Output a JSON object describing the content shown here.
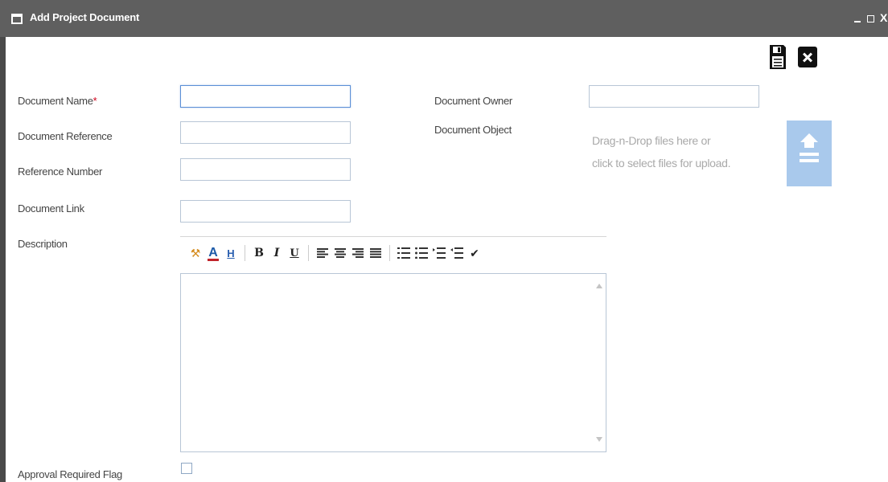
{
  "window": {
    "title": "Add Project Document",
    "close_glyph": "X"
  },
  "form": {
    "document_name_label": "Document Name",
    "required_marker": "*",
    "document_owner_label": "Document Owner",
    "document_reference_label": "Document Reference",
    "document_object_label": "Document Object",
    "reference_number_label": "Reference Number",
    "document_link_label": "Document Link",
    "description_label": "Description",
    "approval_required_label": "Approval Required Flag",
    "document_name_value": "",
    "document_owner_value": "",
    "document_reference_value": "",
    "reference_number_value": "",
    "document_link_value": "",
    "approval_required_checked": false
  },
  "upload": {
    "line1": "Drag-n-Drop files here or",
    "line2": "click to select files for upload."
  },
  "toolbar": {
    "font_color_glyph": "A",
    "highlight_glyph": "H",
    "bold_glyph": "B",
    "italic_glyph": "I",
    "underline_glyph": "U",
    "paint_glyph": "⚒",
    "clear_glyph": "✔"
  },
  "colors": {
    "titlebar": "#5f5f5f",
    "upload_button": "#a9c9ec",
    "required": "#d0021b"
  },
  "icons": [
    "window-icon",
    "minimize-icon",
    "maximize-icon",
    "close-icon",
    "save-icon",
    "cancel-icon",
    "upload-icon"
  ]
}
